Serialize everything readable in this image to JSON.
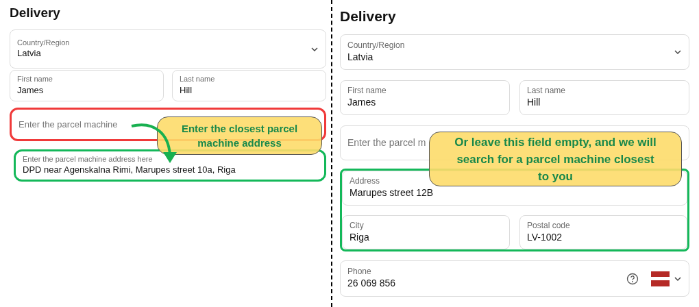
{
  "left": {
    "title": "Delivery",
    "country": {
      "label": "Country/Region",
      "value": "Latvia"
    },
    "first_name": {
      "label": "First name",
      "value": "James"
    },
    "last_name": {
      "label": "Last name",
      "value": "Hill"
    },
    "parcel_field": {
      "placeholder": "Enter the parcel machine",
      "color": "#f03a3a"
    },
    "parcel_result": {
      "label": "Enter the parcel machine address here",
      "value": "DPD near Agenskalna Rimi, Marupes street 10a, Riga",
      "color": "#14b85a"
    },
    "callout": "Enter the closest parcel machine address"
  },
  "right": {
    "title": "Delivery",
    "country": {
      "label": "Country/Region",
      "value": "Latvia"
    },
    "first_name": {
      "label": "First name",
      "value": "James"
    },
    "last_name": {
      "label": "Last name",
      "value": "Hill"
    },
    "parcel_field": {
      "placeholder": "Enter the parcel m"
    },
    "address_group": {
      "color": "#14b85a",
      "address": {
        "label": "Address",
        "value": "Marupes street 12B"
      },
      "city": {
        "label": "City",
        "value": "Riga"
      },
      "postal_code": {
        "label": "Postal code",
        "value": "LV-1002"
      }
    },
    "phone": {
      "label": "Phone",
      "value": "26 069 856"
    },
    "callout": "Or leave this field empty, and we will search for a parcel machine closest to you"
  }
}
